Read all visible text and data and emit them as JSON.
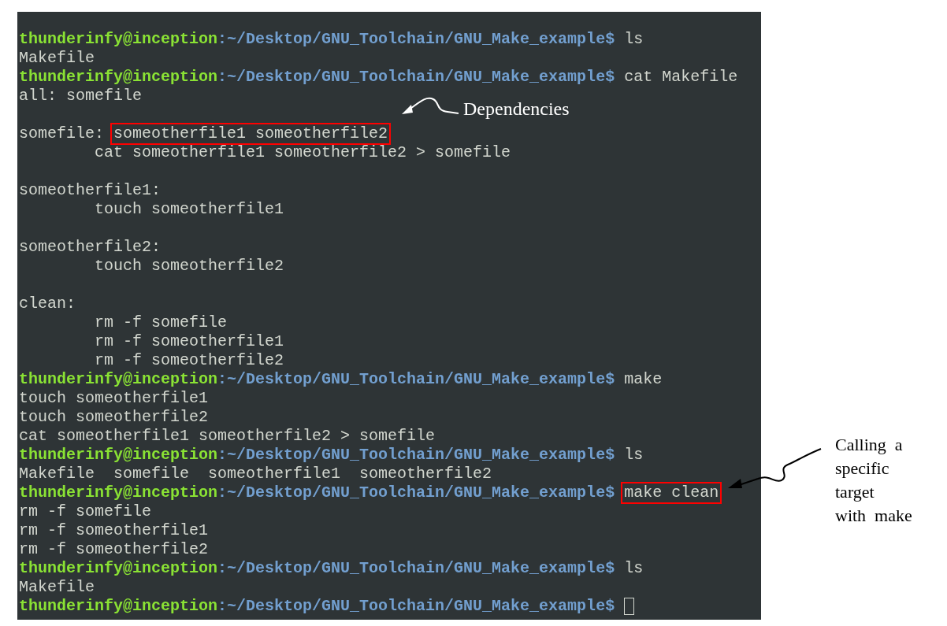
{
  "terminal": {
    "lines": [
      {
        "kind": "prompt",
        "user": "thunderinfy@inception",
        "path": ":~/Desktop/GNU_Toolchain/GNU_Make_example$",
        "command": "ls"
      },
      {
        "kind": "output",
        "text": "Makefile"
      },
      {
        "kind": "prompt",
        "user": "thunderinfy@inception",
        "path": ":~/Desktop/GNU_Toolchain/GNU_Make_example$",
        "command": "cat Makefile"
      },
      {
        "kind": "output",
        "text": "all: somefile"
      },
      {
        "kind": "blank"
      },
      {
        "kind": "output",
        "text": "somefile:",
        "highlight": "someotherfile1 someotherfile2"
      },
      {
        "kind": "recipe",
        "text": "cat someotherfile1 someotherfile2 > somefile"
      },
      {
        "kind": "blank"
      },
      {
        "kind": "output",
        "text": "someotherfile1:"
      },
      {
        "kind": "recipe",
        "text": "touch someotherfile1"
      },
      {
        "kind": "blank"
      },
      {
        "kind": "output",
        "text": "someotherfile2:"
      },
      {
        "kind": "recipe",
        "text": "touch someotherfile2"
      },
      {
        "kind": "blank"
      },
      {
        "kind": "output",
        "text": "clean:"
      },
      {
        "kind": "recipe",
        "text": "rm -f somefile"
      },
      {
        "kind": "recipe",
        "text": "rm -f someotherfile1"
      },
      {
        "kind": "recipe",
        "text": "rm -f someotherfile2"
      },
      {
        "kind": "prompt",
        "user": "thunderinfy@inception",
        "path": ":~/Desktop/GNU_Toolchain/GNU_Make_example$",
        "command": "make"
      },
      {
        "kind": "output",
        "text": "touch someotherfile1"
      },
      {
        "kind": "output",
        "text": "touch someotherfile2"
      },
      {
        "kind": "output",
        "text": "cat someotherfile1 someotherfile2 > somefile"
      },
      {
        "kind": "prompt",
        "user": "thunderinfy@inception",
        "path": ":~/Desktop/GNU_Toolchain/GNU_Make_example$",
        "command": "ls"
      },
      {
        "kind": "output",
        "text": "Makefile  somefile  someotherfile1  someotherfile2"
      },
      {
        "kind": "prompt",
        "user": "thunderinfy@inception",
        "path": ":~/Desktop/GNU_Toolchain/GNU_Make_example$",
        "command": "make clean",
        "highlight": true
      },
      {
        "kind": "output",
        "text": "rm -f somefile"
      },
      {
        "kind": "output",
        "text": "rm -f someotherfile1"
      },
      {
        "kind": "output",
        "text": "rm -f someotherfile2"
      },
      {
        "kind": "prompt",
        "user": "thunderinfy@inception",
        "path": ":~/Desktop/GNU_Toolchain/GNU_Make_example$",
        "command": "ls"
      },
      {
        "kind": "output",
        "text": "Makefile"
      },
      {
        "kind": "prompt",
        "user": "thunderinfy@inception",
        "path": ":~/Desktop/GNU_Toolchain/GNU_Make_example$",
        "cursor": true
      }
    ]
  },
  "annotations": [
    {
      "kind": "dependencies",
      "lines": [
        "Dependencies"
      ]
    },
    {
      "kind": "target",
      "lines": [
        "Calling  a",
        "specific",
        "target",
        "with  make"
      ]
    }
  ]
}
